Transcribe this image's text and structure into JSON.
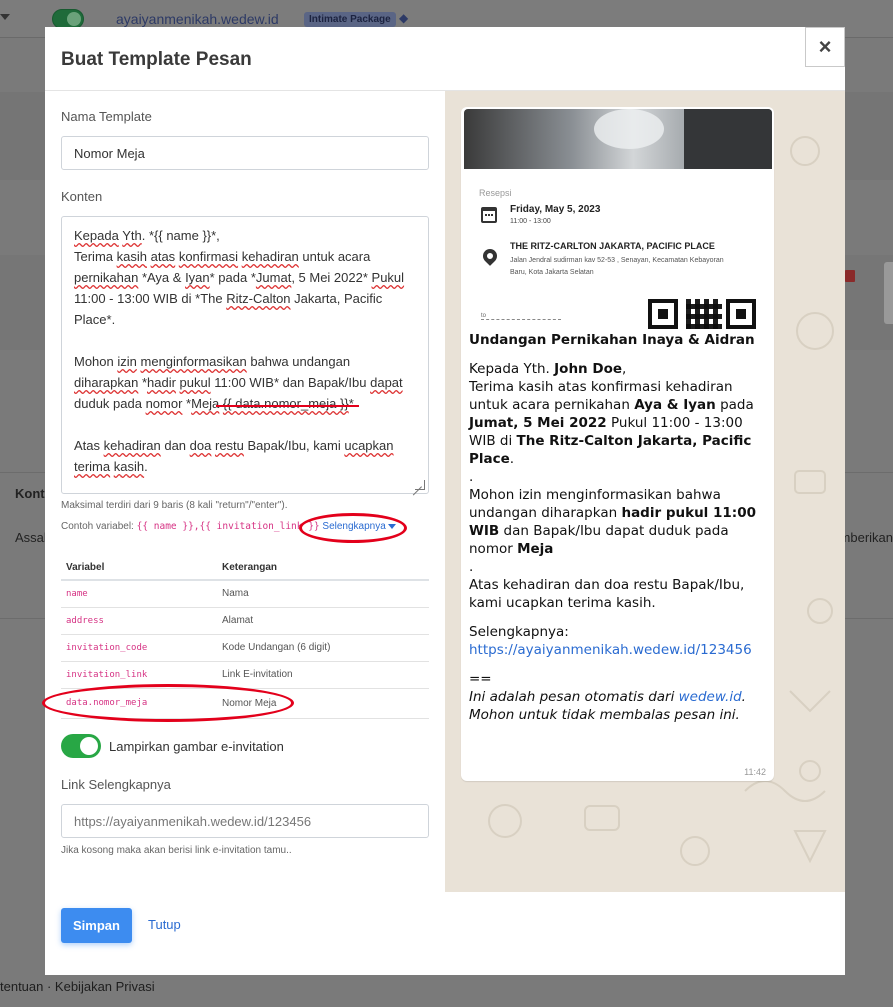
{
  "background": {
    "site": "ayaiyanmenikah.wedew.id",
    "package_badge": "Intimate Package",
    "col_fragment": "Kont",
    "row_fragment_left": "Assal",
    "row_fragment_right": "mberikan",
    "footer": "tentuan · Kebijakan Privasi"
  },
  "modal": {
    "title": "Buat Template Pesan",
    "close_glyph": "×",
    "template_name_label": "Nama Template",
    "template_name_value": "Nomor Meja",
    "content_label": "Konten",
    "content_lines": [
      [
        "Kepada Yth. *{{ name }}*,"
      ],
      [
        "Terima kasih atas konfirmasi kehadiran untuk acara"
      ],
      [
        "pernikahan *Aya & Iyan* pada *Jumat, 5 Mei 2022* Pukul"
      ],
      [
        "11:00 - 13:00 WIB di *The Ritz-Calton Jakarta, Pacific"
      ],
      [
        "Place*."
      ],
      [
        ""
      ],
      [
        "Mohon izin menginformasikan bahwa undangan"
      ],
      [
        "diharapkan *hadir pukul 11:00 WIB* dan Bapak/Ibu dapat"
      ],
      [
        "duduk pada nomor *Meja {{ data.nomor_meja }}*"
      ],
      [
        ""
      ],
      [
        "Atas kehadiran dan doa restu Bapak/Ibu, kami ucapkan"
      ],
      [
        "terima kasih."
      ]
    ],
    "max_hint": "Maksimal terdiri dari 9 baris (8 kali \"return\"/\"enter\").",
    "example_prefix": "Contoh variabel: ",
    "example_codes": "{{ name }},{{ invitation_link }}",
    "example_more": "Selengkapnya",
    "table": {
      "headers": [
        "Variabel",
        "Keterangan"
      ],
      "rows": [
        [
          "name",
          "Nama"
        ],
        [
          "address",
          "Alamat"
        ],
        [
          "invitation_code",
          "Kode Undangan (6 digit)"
        ],
        [
          "invitation_link",
          "Link E-invitation"
        ],
        [
          "data.nomor_meja",
          "Nomor Meja"
        ]
      ]
    },
    "attach_toggle_label": "Lampirkan gambar e-invitation",
    "attach_toggle_on": true,
    "link_label": "Link Selengkapnya",
    "link_placeholder": "https://ayaiyanmenikah.wedew.id/123456",
    "link_hint": "Jika kosong maka akan berisi link e-invitation tamu..",
    "save_button": "Simpan",
    "close_button": "Tutup"
  },
  "preview": {
    "event_label": "Resepsi",
    "event_date": "Friday, May 5, 2023",
    "event_time": "11:00 - 13:00",
    "venue_name": "THE RITZ-CARLTON JAKARTA, PACIFIC PLACE",
    "venue_address": "Jalan Jendral sudirman kav 52-53 , Senayan, Kecamatan Kebayoran Baru, Kota Jakarta Selatan",
    "cut_fragment": "to",
    "msg_title": "Undangan Pernikahan Inaya & Aidran",
    "greeting_prefix": "Kepada Yth. ",
    "guest_name": "John Doe",
    "greeting_suffix": ",",
    "p1_a": "Terima kasih atas konfirmasi kehadiran untuk acara pernikahan ",
    "p1_couple": "Aya & Iyan",
    "p1_b": " pada ",
    "p1_date": "Jumat, 5 Mei 2022",
    "p1_c": " Pukul 11:00 - 13:00 WIB di ",
    "p1_venue": "The Ritz-Calton Jakarta, Pacific Place",
    "p1_d": ".",
    "dot1": ".",
    "p2_a": "Mohon izin menginformasikan bahwa undangan diharapkan ",
    "p2_bold": "hadir pukul 11:00 WIB",
    "p2_b": " dan Bapak/Ibu dapat duduk pada nomor ",
    "p2_meja": "Meja",
    "dot2": ".",
    "p3": "Atas kehadiran dan doa restu Bapak/Ibu, kami ucapkan terima kasih.",
    "more_label": "Selengkapnya:",
    "more_link": "https://ayaiyanmenikah.wedew.id/123456",
    "separator": "==",
    "auto_a": "Ini adalah pesan otomatis dari ",
    "auto_link": "wedew.id",
    "auto_b": ".",
    "auto_c": "Mohon untuk tidak membalas pesan ini.",
    "time": "11:42"
  },
  "colors": {
    "accent": "#3d8cf0",
    "toggle_on": "#28a745",
    "annotation": "#e3001b",
    "variable_code": "#d63384"
  }
}
